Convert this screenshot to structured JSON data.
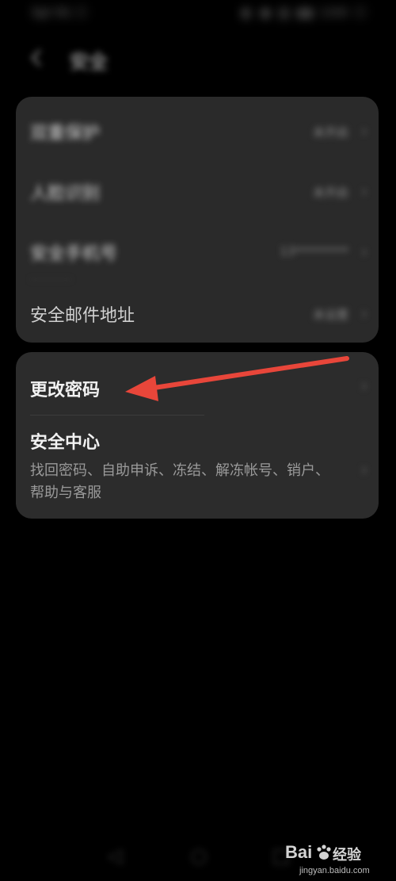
{
  "status_bar": {
    "left": "Spl 91 ☐",
    "right": "◐ ◉ ▥ ▮▮ 100 ☐"
  },
  "header": {
    "back_icon": "back-arrow-icon",
    "title": "安全"
  },
  "card1": {
    "items": [
      {
        "label": "双重保护",
        "value": "未开启"
      },
      {
        "label": "人脸识别",
        "value": "未开启"
      },
      {
        "label": "安全手机号",
        "value": "13*********"
      },
      {
        "label": "安全邮件地址",
        "value": "未设置"
      }
    ]
  },
  "card2": {
    "change_password": "更改密码",
    "security_center": {
      "title": "安全中心",
      "description": "找回密码、自助申诉、冻结、解冻帐号、销户、帮助与客服"
    }
  },
  "annotation": {
    "arrow_color": "#e8463a"
  },
  "nav_bar": {
    "back": "◁",
    "home": "○",
    "recent": "□"
  },
  "watermark": {
    "brand": "Bai",
    "text": "经验",
    "url": "jingyan.baidu.com"
  }
}
